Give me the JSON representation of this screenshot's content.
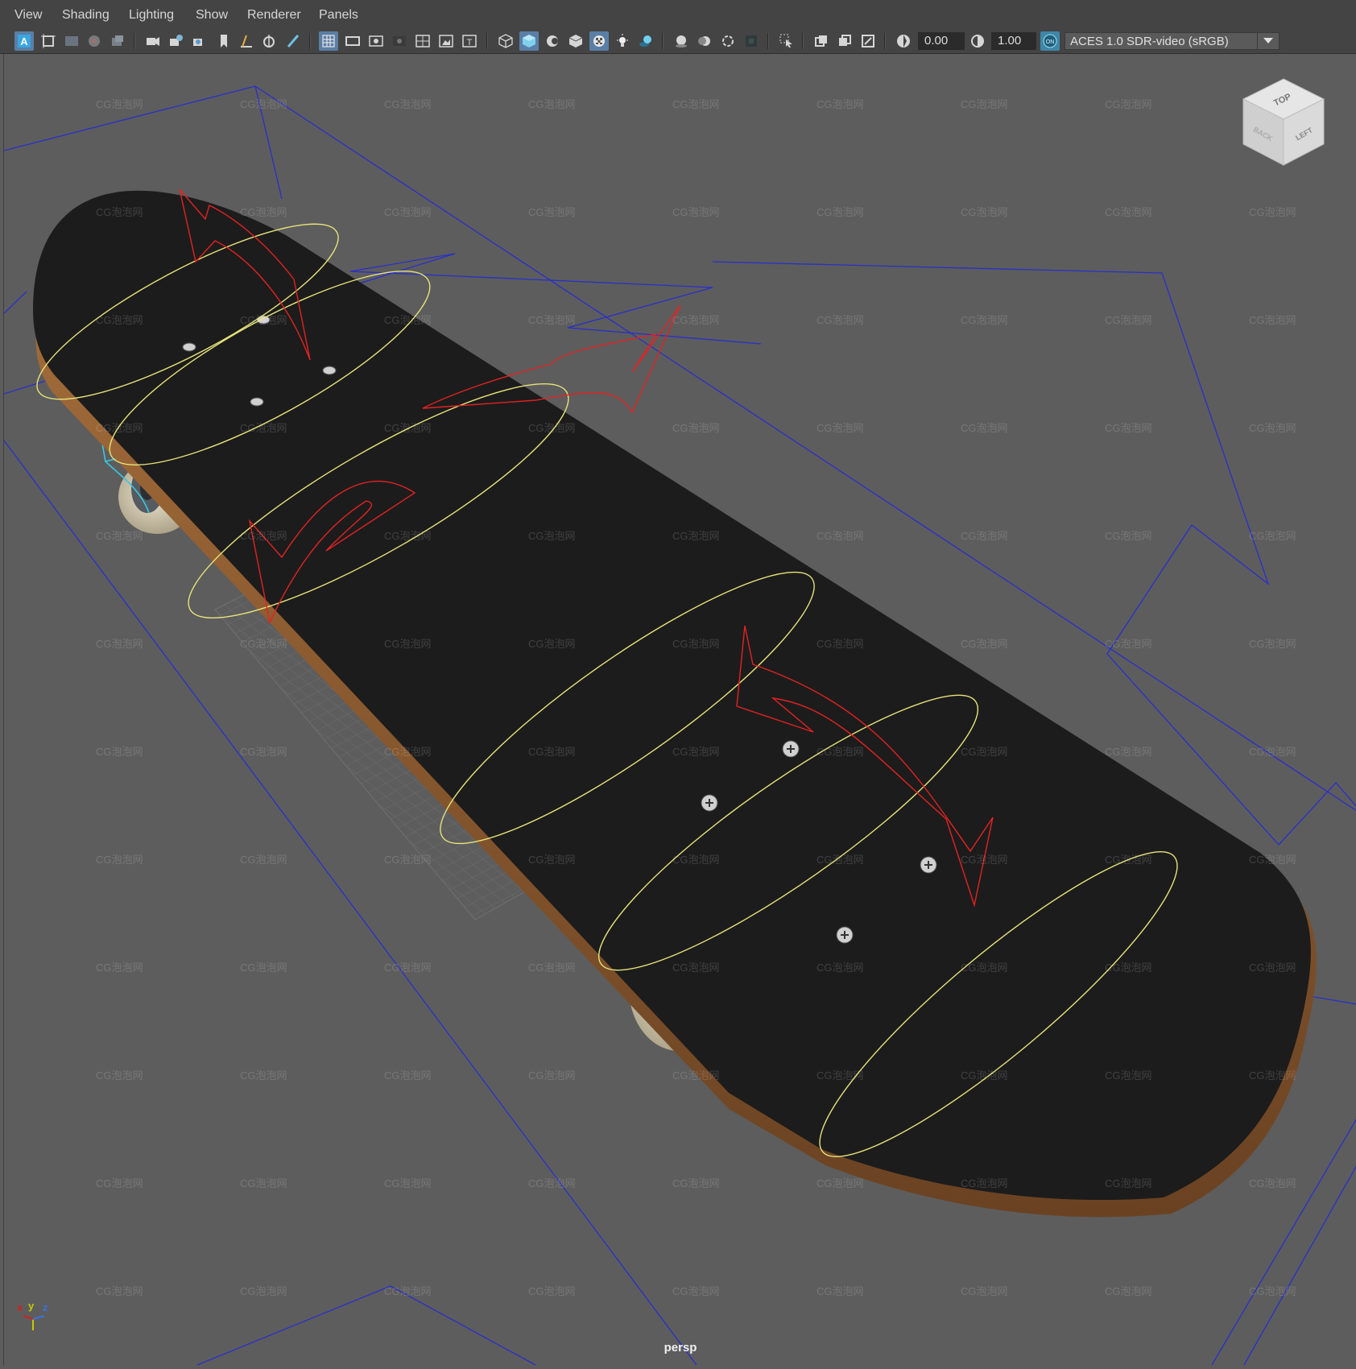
{
  "menu": [
    "View",
    "Shading",
    "Lighting",
    "Show",
    "Renderer",
    "Panels"
  ],
  "toolbar": {
    "exposure_value": "0.00",
    "gamma_value": "1.00",
    "color_management_badge": "ON",
    "color_space": "ACES 1.0 SDR-video (sRGB)"
  },
  "viewport": {
    "camera": "persp",
    "watermark": "CG泡泡网",
    "viewcube_faces": [
      "TOP",
      "LEFT",
      "BACK"
    ],
    "axis_labels": [
      "x",
      "y",
      "z"
    ]
  },
  "colors": {
    "curve_yellow": "#e6e47a",
    "control_red": "#e32222",
    "bbox_blue": "#2a2fc9",
    "wheel_cyan": "#38c8e0",
    "deck_black": "#1c1c1c",
    "wood": "#8a5a32"
  }
}
